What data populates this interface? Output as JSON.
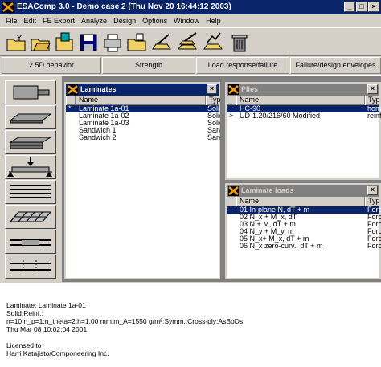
{
  "window": {
    "title": "ESAComp 3.0 - Demo case 2 (Thu Nov 20 16:44:12 2003)",
    "controls": [
      "_",
      "□",
      "×"
    ]
  },
  "menu": [
    "File",
    "Edit",
    "FE Export",
    "Analyze",
    "Design",
    "Options",
    "Window",
    "Help"
  ],
  "toolbar": [
    "new-folder-icon",
    "open-folder-icon",
    "save-icon",
    "save-as-icon",
    "print-icon",
    "folder-icon",
    "edit-item-icon",
    "stack-edit-icon",
    "properties-icon",
    "trash-icon"
  ],
  "tabs": [
    "2.5D behavior",
    "Strength",
    "Load response/failure",
    "Failure/design envelopes"
  ],
  "laminates": {
    "title": "Laminates",
    "columns": [
      "Name",
      "Typ"
    ],
    "rows": [
      {
        "mark": "*",
        "name": "Laminate 1a-01",
        "type": "Solid"
      },
      {
        "mark": "",
        "name": "Laminate 1a-02",
        "type": "Solid"
      },
      {
        "mark": "",
        "name": "Laminate 1a-03",
        "type": "Solid"
      },
      {
        "mark": "",
        "name": "Sandwich 1",
        "type": "Sand"
      },
      {
        "mark": "",
        "name": "Sandwich 2",
        "type": "Sand"
      }
    ]
  },
  "plies": {
    "title": "Plies",
    "columns": [
      "Name",
      "Typ"
    ],
    "rows": [
      {
        "mark": "",
        "name": "HC-90",
        "type": "homo"
      },
      {
        "mark": ">",
        "name": "UD-1.20/216/60 Modified",
        "type": "reinf"
      }
    ]
  },
  "loads": {
    "title": "Laminate loads",
    "columns": [
      "Name",
      "Typ"
    ],
    "rows": [
      {
        "name": "01 In-plane N, dT + m",
        "type": "Forc"
      },
      {
        "name": "02 N_x + M_x, dT",
        "type": "Forc"
      },
      {
        "name": "03 N + M, dT + m",
        "type": "Forc"
      },
      {
        "name": "04 N_y + M_y, m",
        "type": "Forc"
      },
      {
        "name": "05 N_x+ M_x, dT + m",
        "type": "Forc"
      },
      {
        "name": "06 N_x zero-curv., dT + m",
        "type": "Forc"
      }
    ]
  },
  "status": {
    "line1": "Laminate: Laminate 1a-01",
    "line2": "Solid;Reinf.;",
    "line3": "n=10;n_p=1;n_theta=2;h=1.00 mm;m_A=1550 g/m²;Symm.;Cross-ply;AsBoDs",
    "line4": "Thu Mar 08 10:02:04 2001",
    "line5": "Licensed to",
    "line6": "Harri Katajisto/Componeering Inc."
  },
  "colors": {
    "active_caption": "#0a246a",
    "inactive_caption": "#808080",
    "face": "#d4d0c8"
  }
}
